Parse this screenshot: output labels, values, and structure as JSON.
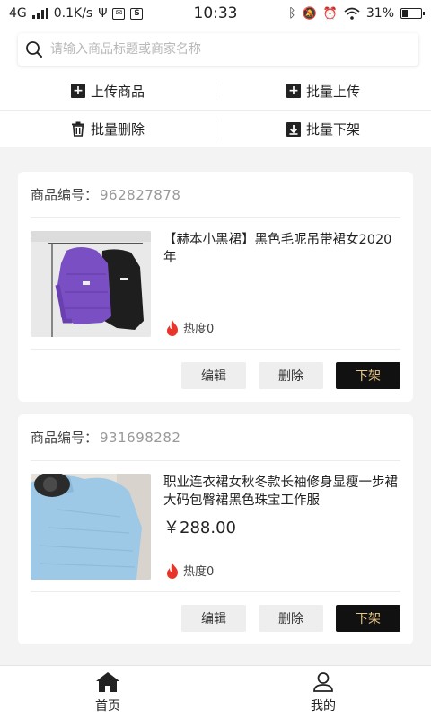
{
  "status_bar": {
    "network": "4G",
    "speed": "0.1K/s",
    "time": "10:33",
    "battery_level": "31%",
    "battery_fraction": 0.31
  },
  "search": {
    "placeholder": "请输入商品标题或商家名称",
    "value": ""
  },
  "actions": {
    "upload": "上传商品",
    "batch_upload": "批量上传",
    "batch_delete": "批量删除",
    "batch_unlist": "批量下架"
  },
  "products": [
    {
      "id_label": "商品编号：",
      "id": "962827878",
      "title": "【赫本小黑裙】黑色毛呢吊带裙女2020年",
      "price": "",
      "heat": "热度0",
      "image": "purple-and-black-puffer-jackets",
      "edit": "编辑",
      "delete": "删除",
      "unlist": "下架"
    },
    {
      "id_label": "商品编号：",
      "id": "931698282",
      "title": "职业连衣裙女秋冬款长袖修身显瘦一步裙大码包臀裙黑色珠宝工作服",
      "price": "￥288.00",
      "heat": "热度0",
      "image": "light-blue-knit-sweater",
      "edit": "编辑",
      "delete": "删除",
      "unlist": "下架"
    }
  ],
  "tabbar": {
    "home": "首页",
    "mine": "我的"
  },
  "colors": {
    "accent_dark": "#111111",
    "accent_gold": "#e8c98e",
    "heat_red": "#e8352b",
    "background": "#f3f3f3"
  }
}
